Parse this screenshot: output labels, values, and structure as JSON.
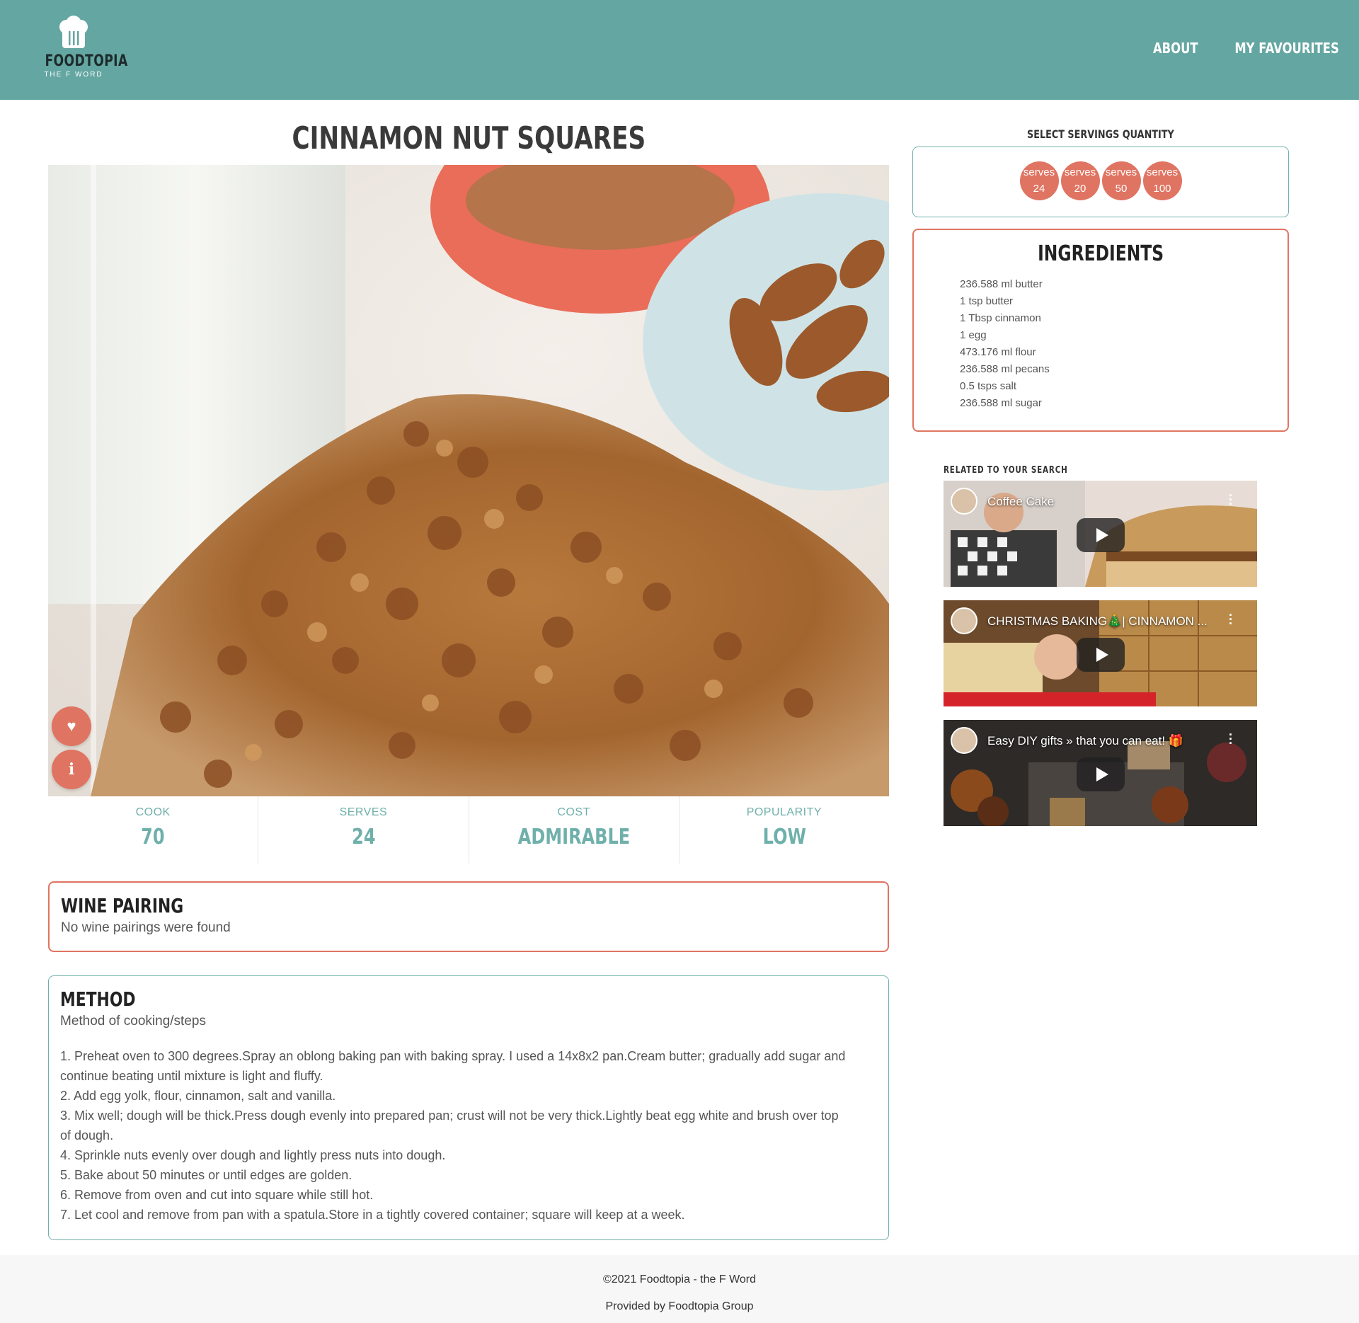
{
  "header": {
    "brand": "FOODTOPIA",
    "tagline": "THE F WORD",
    "nav": [
      "ABOUT",
      "MY FAVOURITES"
    ],
    "color": "#64a6a2"
  },
  "recipe": {
    "title": "CINNAMON NUT SQUARES",
    "stats": [
      {
        "label": "COOK",
        "value": "70"
      },
      {
        "label": "SERVES",
        "value": "24"
      },
      {
        "label": "COST",
        "value": "ADMIRABLE"
      },
      {
        "label": "POPULARITY",
        "value": "LOW"
      }
    ]
  },
  "wine": {
    "title": "WINE PAIRING",
    "text": "No wine pairings were found"
  },
  "method": {
    "title": "METHOD",
    "subtitle": "Method of cooking/steps",
    "steps": [
      "1. Preheat oven to 300 degrees.Spray an oblong baking pan with baking spray. I used a 14x8x2 pan.Cream butter; gradually add sugar and",
      "continue beating until mixture is light and fluffy.",
      "2. Add egg yolk, flour, cinnamon, salt and vanilla.",
      "3. Mix well; dough will be thick.Press dough evenly into prepared pan; crust will not be very thick.Lightly beat egg white and brush over top",
      "of dough.",
      "4. Sprinkle nuts evenly over dough and lightly press nuts into dough.",
      "5. Bake about 50 minutes or until edges are golden.",
      "6. Remove from oven and cut into square while still hot.",
      "7. Let cool and remove from pan with a spatula.Store in a tightly covered container; square will keep at a week."
    ]
  },
  "servings": {
    "label": "SELECT SERVINGS QUANTITY",
    "options": [
      {
        "top": "serves",
        "num": "24"
      },
      {
        "top": "serves",
        "num": "20"
      },
      {
        "top": "serves",
        "num": "50"
      },
      {
        "top": "serves",
        "num": "100"
      }
    ]
  },
  "ingredients": {
    "title": "INGREDIENTS",
    "items": [
      "236.588 ml butter",
      "1 tsp butter",
      "1 Tbsp cinnamon",
      "1 egg",
      "473.176 ml flour",
      "236.588 ml pecans",
      "0.5 tsps salt",
      "236.588 ml sugar"
    ]
  },
  "related": {
    "label": "RELATED TO YOUR SEARCH",
    "videos": [
      {
        "title": "Coffee Cake"
      },
      {
        "title": "CHRISTMAS BAKING🎄| CINNAMON ..."
      },
      {
        "title": "Easy DIY gifts » that you can eat! 🎁"
      }
    ]
  },
  "footer": {
    "copyright": "©2021 Foodtopia - the F Word",
    "provided": "Provided by Foodtopia Group"
  },
  "colors": {
    "accent": "#e07462",
    "teal": "#6fb0ab"
  }
}
